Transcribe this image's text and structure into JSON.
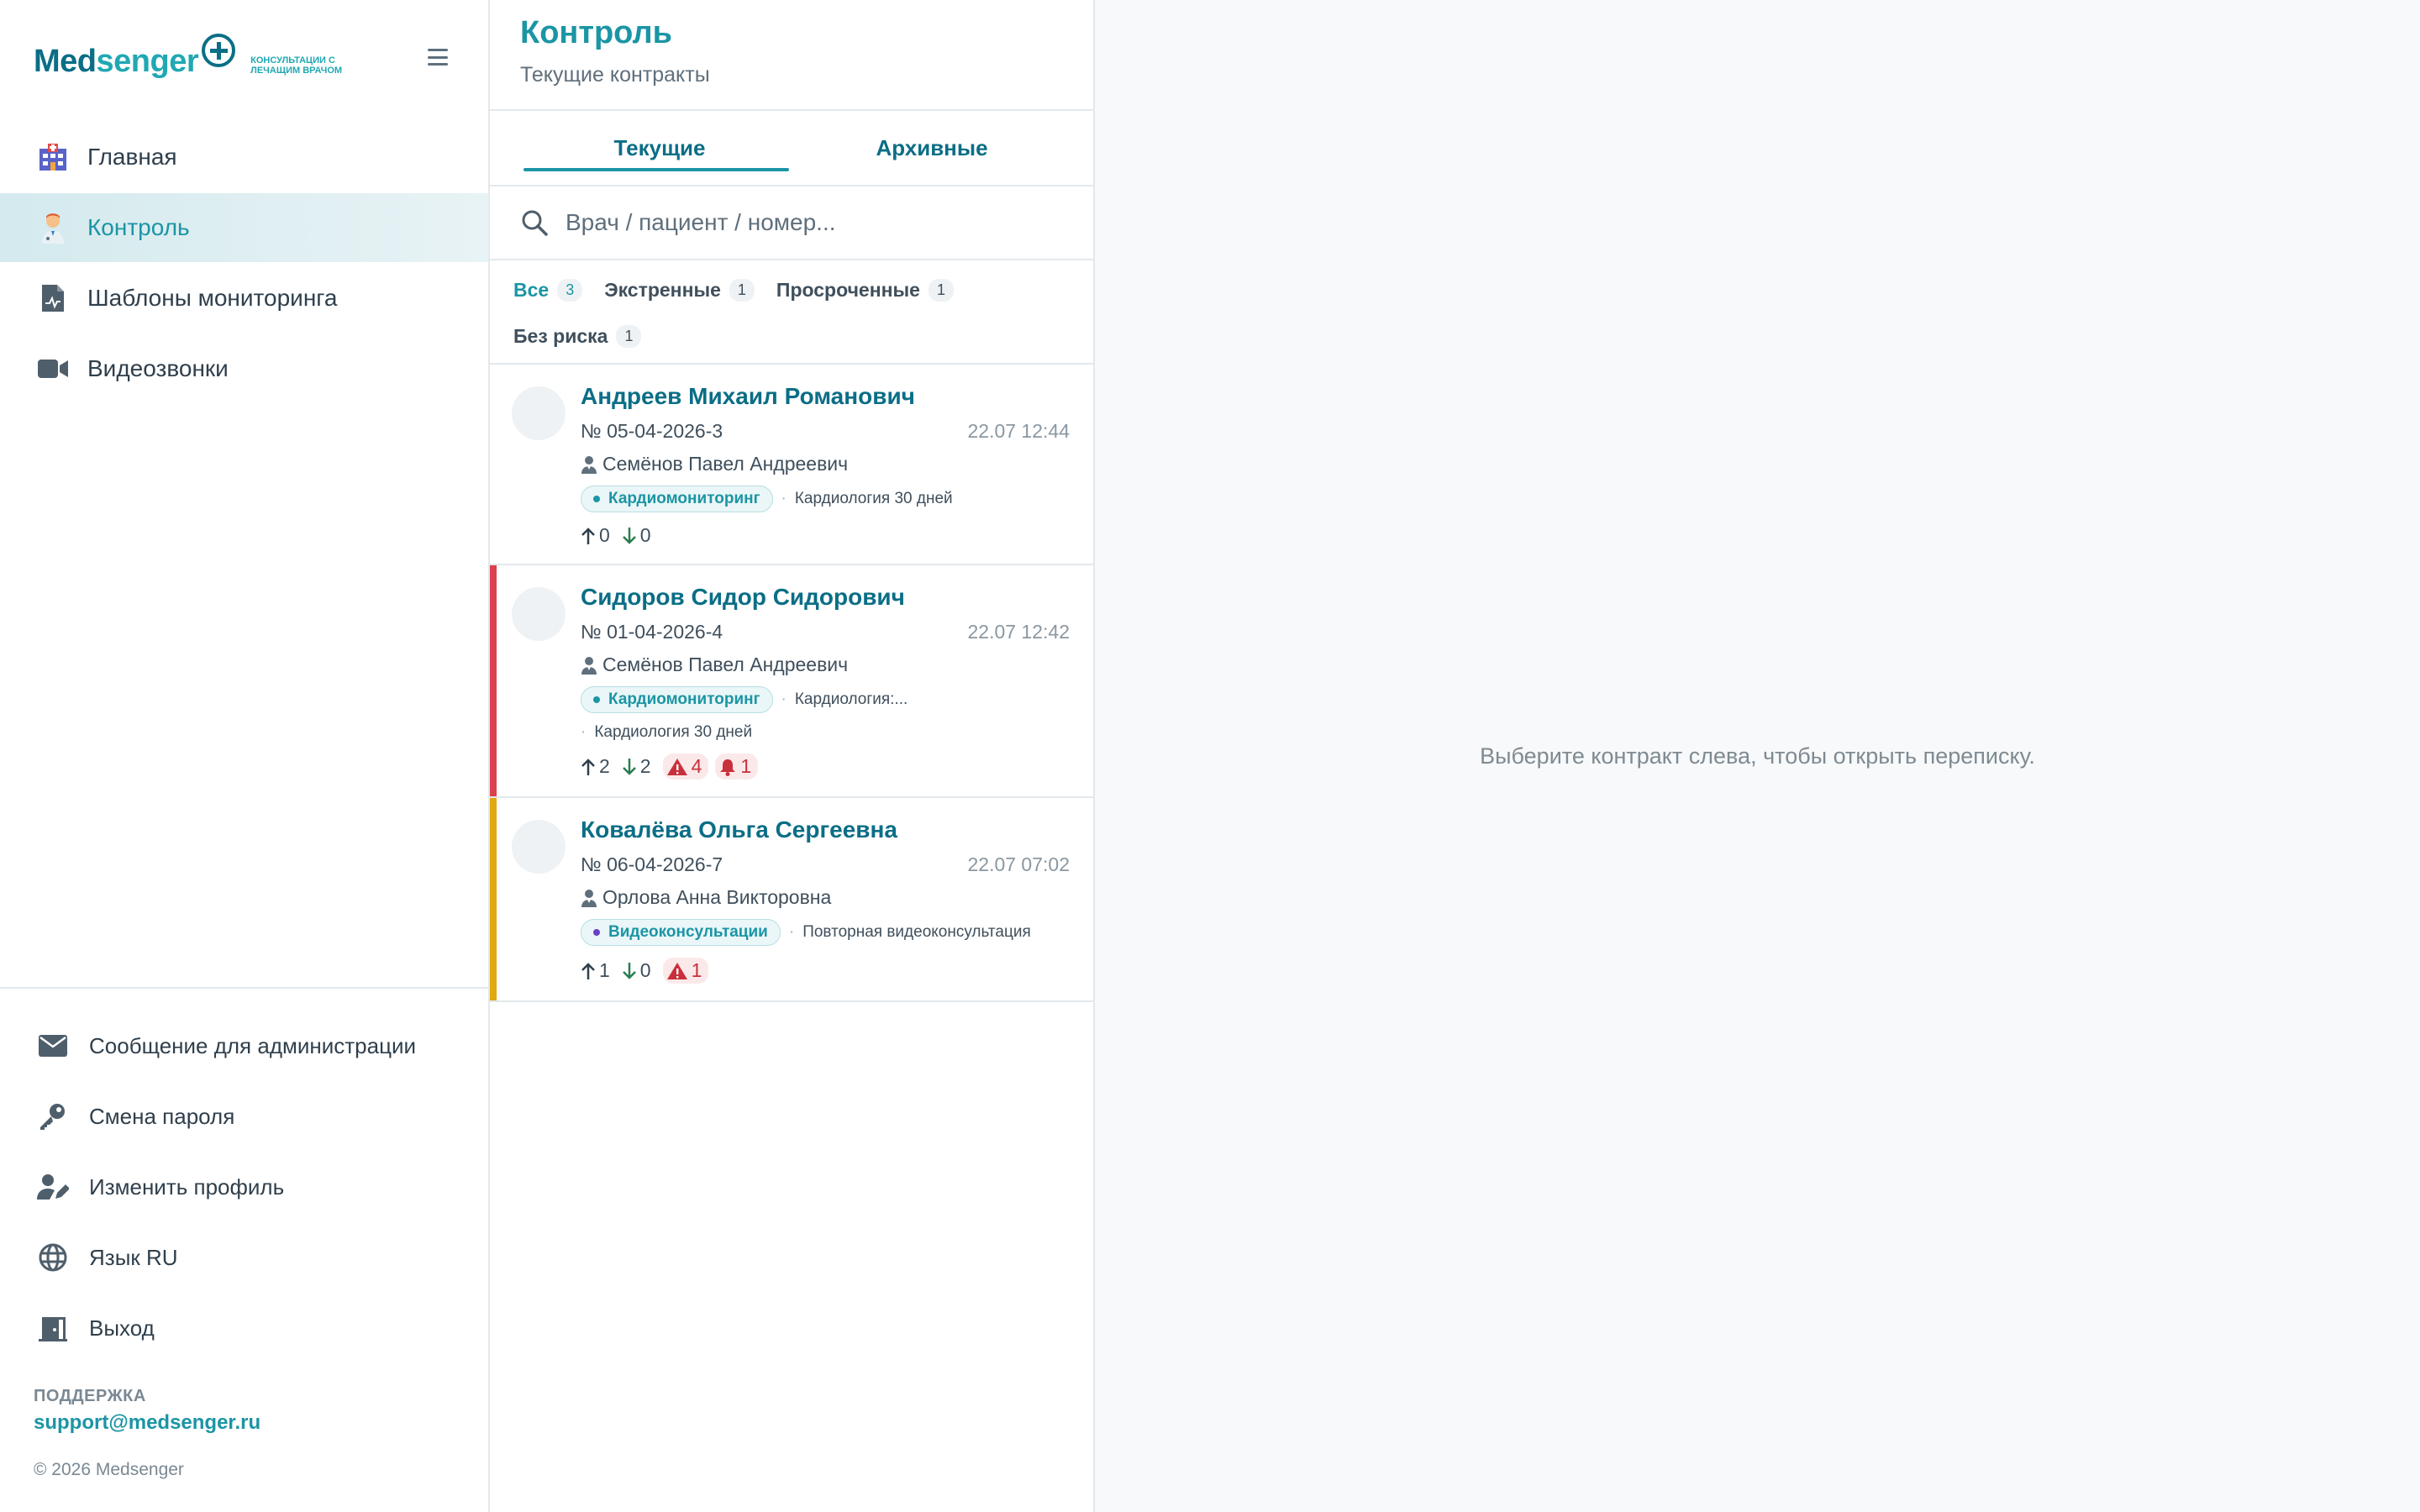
{
  "brand": {
    "name_part1": "Med",
    "name_part2": "senger",
    "tagline": "Консультации с лечащим врачом"
  },
  "sidebar": {
    "nav": [
      {
        "label": "Главная",
        "icon": "hospital-icon"
      },
      {
        "label": "Контроль",
        "icon": "doctor-icon"
      },
      {
        "label": "Шаблоны мониторинга",
        "icon": "file-chart-icon"
      },
      {
        "label": "Видеозвонки",
        "icon": "video-camera-icon"
      }
    ],
    "bottom": [
      {
        "label": "Сообщение для администрации",
        "icon": "envelope-icon"
      },
      {
        "label": "Смена пароля",
        "icon": "key-icon"
      },
      {
        "label": "Изменить профиль",
        "icon": "user-edit-icon"
      },
      {
        "label": "Язык RU",
        "icon": "globe-icon"
      },
      {
        "label": "Выход",
        "icon": "door-exit-icon"
      }
    ],
    "support_title": "ПОДДЕРЖКА",
    "support_email": "support@medsenger.ru",
    "copyright": "© 2026 Medsenger"
  },
  "list_panel": {
    "title": "Контроль",
    "subtitle": "Текущие контракты",
    "tabs": [
      "Текущие",
      "Архивные"
    ],
    "search_placeholder": "Врач / пациент / номер...",
    "filters": [
      {
        "label": "Все",
        "count": "3"
      },
      {
        "label": "Экстренные",
        "count": "1"
      },
      {
        "label": "Просроченные",
        "count": "1"
      },
      {
        "label": "Без риска",
        "count": "1"
      }
    ],
    "contracts": [
      {
        "patient": "Андреев Михаил Романович",
        "number": "№ 05-04-2026-3",
        "time": "22.07 12:44",
        "doctor": "Семёнов Павел Андреевич",
        "service": "Кардиомониторинг",
        "service_dot": "#1b95a5",
        "extra1": "Кардиология 30 дней",
        "extra2": "",
        "up": "0",
        "down": "0",
        "warnings": "",
        "alarms": "",
        "flag_color": ""
      },
      {
        "patient": "Сидоров Сидор Сидорович",
        "number": "№ 01-04-2026-4",
        "time": "22.07 12:42",
        "doctor": "Семёнов Павел Андреевич",
        "service": "Кардиомониторинг",
        "service_dot": "#1b95a5",
        "extra1": "Кардиология:...",
        "extra2": "Кардиология 30 дней",
        "up": "2",
        "down": "2",
        "warnings": "4",
        "alarms": "1",
        "flag_color": "#d9414d"
      },
      {
        "patient": "Ковалёва Ольга Сергеевна",
        "number": "№ 06-04-2026-7",
        "time": "22.07 07:02",
        "doctor": "Орлова Анна Викторовна",
        "service": "Видеоконсультации",
        "service_dot": "#6a3fc4",
        "extra1": "Повторная видеоконсультация",
        "extra2": "",
        "up": "1",
        "down": "0",
        "warnings": "1",
        "alarms": "",
        "flag_color": "#e0a812"
      }
    ]
  },
  "chat_panel": {
    "empty_message": "Выберите контракт слева, чтобы открыть переписку."
  },
  "colors": {
    "accent": "#1b95a5",
    "brand_dark": "#0b6e86",
    "danger": "#d9414d",
    "warning": "#e0a812"
  }
}
